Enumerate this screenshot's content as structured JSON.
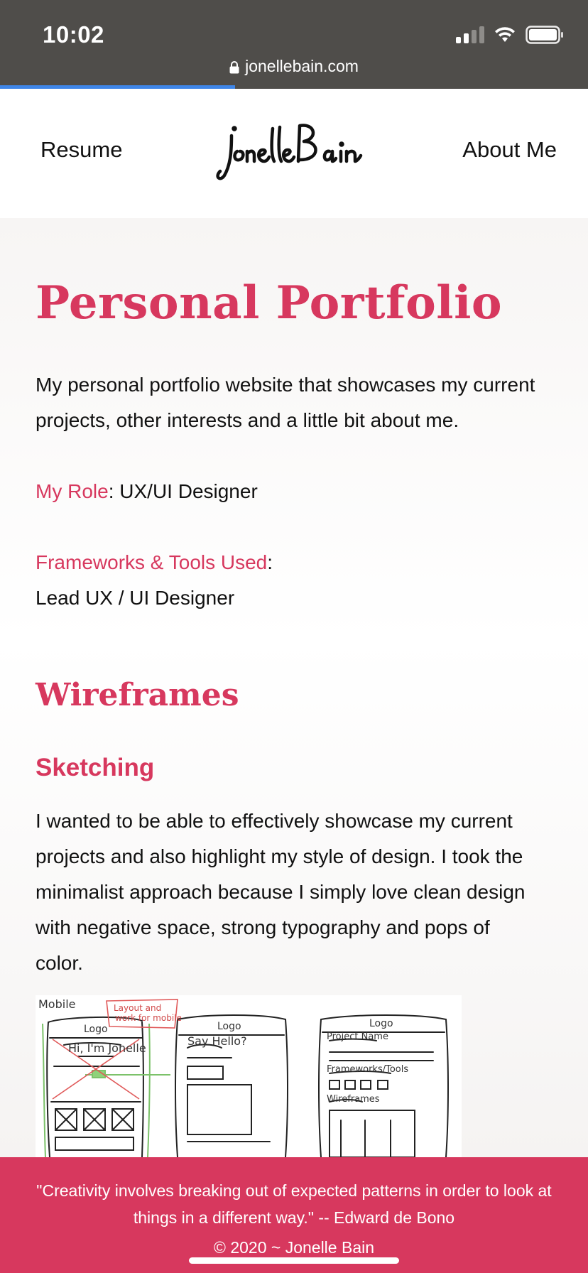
{
  "status_bar": {
    "time": "10:02",
    "url": "jonellebain.com",
    "load_progress_percent": 40
  },
  "nav": {
    "left_link": "Resume",
    "logo_text": "JonelleBain",
    "right_link": "About Me"
  },
  "page": {
    "title": "Personal Portfolio",
    "intro": "My personal portfolio website that showcases my current projects, other interests and a little bit about me.",
    "role_label": "My Role",
    "role_value": ": UX/UI Designer",
    "tools_label": "Frameworks & Tools Used",
    "tools_colon": ":",
    "tools_value": "Lead UX / UI Designer",
    "section_heading": "Wireframes",
    "subsection_heading": "Sketching",
    "sketch_text": "I wanted to be able to effectively showcase my current projects and also  highlight my style of  design. I took the minimalist approach because I simply love clean design with negative space,  strong typography and pops of color.",
    "sketch_image": {
      "caption_labels": [
        "Mobile",
        "Layout and work for mobile",
        "Logo",
        "Hi, I'm Jonelle",
        "Logo",
        "Say Hello?",
        "Logo",
        "Project Name",
        "Frameworks/Tools",
        "Wireframes"
      ]
    }
  },
  "footer": {
    "quote": "\"Creativity involves breaking out of expected patterns in order to look at things in a different way.\" -- Edward de Bono",
    "copyright": "© 2020 ~ Jonelle Bain"
  },
  "colors": {
    "accent": "#d7385e",
    "status_bar": "#4f4d4a",
    "progress": "#3f86e8"
  }
}
